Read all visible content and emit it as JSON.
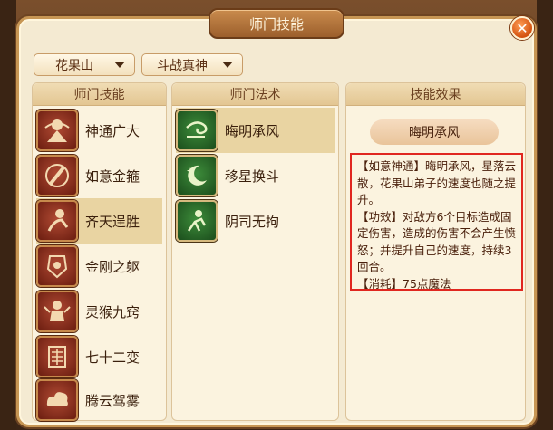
{
  "window": {
    "title": "师门技能"
  },
  "dropdowns": {
    "school": "花果山",
    "sect_skill": "斗战真神"
  },
  "columns": {
    "skills": "师门技能",
    "spells": "师门法术",
    "effects": "技能效果"
  },
  "skills": [
    {
      "label": "神通广大",
      "icon": "monkey-king-icon"
    },
    {
      "label": "如意金箍",
      "icon": "golden-cudgel-icon"
    },
    {
      "label": "齐天逞胜",
      "icon": "monkey-leap-icon"
    },
    {
      "label": "金刚之躯",
      "icon": "armor-icon"
    },
    {
      "label": "灵猴九窍",
      "icon": "monkey-icon"
    },
    {
      "label": "七十二变",
      "icon": "transform-glyph-icon"
    },
    {
      "label": "腾云驾雾",
      "icon": "cloud-icon"
    }
  ],
  "spells": [
    {
      "label": "晦明承风",
      "icon": "wind-swirl-icon"
    },
    {
      "label": "移星换斗",
      "icon": "moon-star-icon"
    },
    {
      "label": "阴司无拘",
      "icon": "spirit-figure-icon"
    }
  ],
  "effect": {
    "name": "晦明承风",
    "lines": [
      "【如意神通】晦明承风，星落云散，花果山弟子的速度也随之提升。",
      "【功效】对敌方6个目标造成固定伤害，造成的伤害不会产生愤怒；并提升自己的速度，持续3回合。",
      "【消耗】75点魔法"
    ]
  },
  "colors": {
    "accent": "#e0261f",
    "frame": "#c79654",
    "title_bg": "#9c5f2c"
  }
}
